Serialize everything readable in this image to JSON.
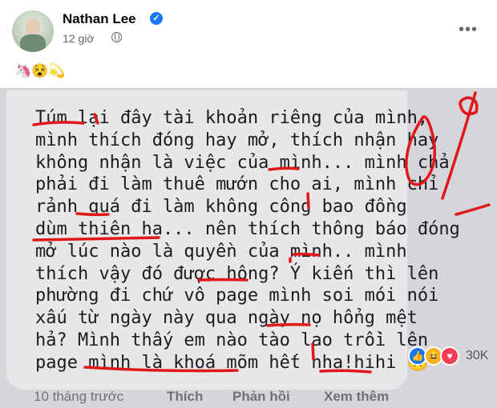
{
  "post": {
    "author": "Nathan Lee",
    "verified_mark": "✓",
    "time": "12 giờ",
    "more_label": "•••",
    "caption_emojis": "🦄😵💫"
  },
  "screenshot": {
    "comment_lines": [
      "Túm lại đây tài khoản riêng của mình,",
      "mình thích đóng hay mở, thích nhận hay",
      "không nhận là việc của mình... mình chả",
      "phải đi làm thuê mướn cho ai, mình chỉ",
      "rảnh quá đi làm không công bao đồng",
      "dùm thiên hạ... nên thích thông báo đóng",
      "mở lúc nào là quyền của mình.. mình",
      "thích vậy đó được hông? Ý kiến thì lên",
      "phường đi chứ vô page mình soi mói nói",
      "xấu từ ngày này qua ngày nọ hổng mệt",
      "hả? Mình thấy em nào tào lao trồi lên",
      "page mình là khoá mõm hết nha!hihi 🙁"
    ],
    "reaction_count": "30K",
    "reactions": [
      "like",
      "haha",
      "love"
    ],
    "actions": {
      "time": "10 tháng trước",
      "like": "Thích",
      "reply": "Phản hồi",
      "see_more": "Xem thêm"
    },
    "handwritten_mark": "0%",
    "colors": {
      "annotation": "#e0181a",
      "like": "#1877f2",
      "love": "#f33e58",
      "haha": "#f7b125"
    }
  }
}
